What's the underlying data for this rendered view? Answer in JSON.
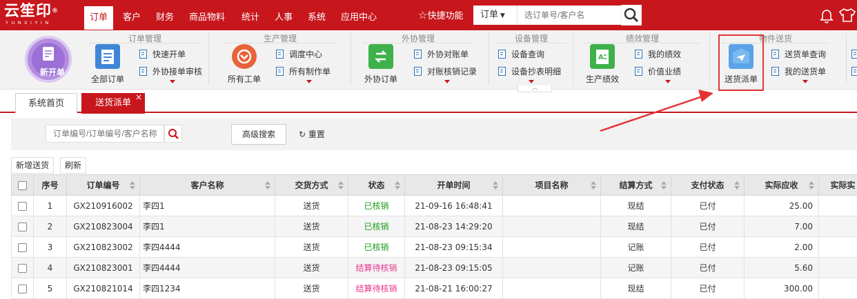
{
  "brand": {
    "name": "云笙印",
    "reg": "®",
    "sub": "YUNXIYIN"
  },
  "nav": [
    "订单",
    "客户",
    "财务",
    "商品物料",
    "统计",
    "人事",
    "系统",
    "应用中心"
  ],
  "quick_label": "快捷功能",
  "search": {
    "select": "订单",
    "placeholder": "选订单号/客户名"
  },
  "ribbon": {
    "new_order": "新开单",
    "groups": [
      {
        "title": "订单管理",
        "big": "全部订单",
        "items": [
          "快速开单",
          "外协接单审核"
        ]
      },
      {
        "title": "生产管理",
        "big": "所有工单",
        "items": [
          "调度中心",
          "所有制作单"
        ]
      },
      {
        "title": "外协管理",
        "big": "外协订单",
        "items": [
          "外协对账单",
          "对账核销记录"
        ]
      },
      {
        "title": "设备管理",
        "items": [
          "设备查询",
          "设备抄表明细"
        ]
      },
      {
        "title": "绩效管理",
        "big": "生产绩效",
        "items": [
          "我的绩效",
          "价值业绩"
        ]
      },
      {
        "title": "物件送货",
        "big": "送货派单",
        "items": [
          "送货单查询",
          "我的送货单"
        ]
      }
    ]
  },
  "tabs": [
    "系统首页",
    "送货派单"
  ],
  "tab_close": "×",
  "filter": {
    "placeholder": "订单编号/订单编号/客户名称",
    "advanced": "高级搜索",
    "reset": "重置"
  },
  "toolbar": {
    "add": "新增送货",
    "refresh": "刷新"
  },
  "table": {
    "columns": [
      "序号",
      "订单编号",
      "客户名称",
      "交货方式",
      "状态",
      "开单时间",
      "项目名称",
      "结算方式",
      "支付状态",
      "实际应收",
      "实际实"
    ],
    "rows": [
      {
        "no": "1",
        "order": "GX210916002",
        "customer": "李四1",
        "delivery": "送货",
        "status": "已核销",
        "time": "21-09-16 16:48:41",
        "project": "",
        "settle": "现结",
        "pay": "已付",
        "amount": "25.00"
      },
      {
        "no": "2",
        "order": "GX210823004",
        "customer": "李四1",
        "delivery": "送货",
        "status": "已核销",
        "time": "21-08-23 14:29:20",
        "project": "",
        "settle": "现结",
        "pay": "已付",
        "amount": "7.00"
      },
      {
        "no": "3",
        "order": "GX210823002",
        "customer": "李四4444",
        "delivery": "送货",
        "status": "已核销",
        "time": "21-08-23 09:15:34",
        "project": "",
        "settle": "记账",
        "pay": "已付",
        "amount": "2.00"
      },
      {
        "no": "4",
        "order": "GX210823001",
        "customer": "李四4444",
        "delivery": "送货",
        "status": "结算待核销",
        "time": "21-08-23 09:15:05",
        "project": "",
        "settle": "记账",
        "pay": "已付",
        "amount": "5.60"
      },
      {
        "no": "5",
        "order": "GX210821014",
        "customer": "李四1234",
        "delivery": "送货",
        "status": "结算待核销",
        "time": "21-08-21 16:00:27",
        "project": "",
        "settle": "现结",
        "pay": "已付",
        "amount": "300.00"
      }
    ]
  },
  "colors": {
    "brand": "#c8161d",
    "ok": "#1c9c1c",
    "pending": "#e8368f",
    "highlight": "#e53333"
  }
}
